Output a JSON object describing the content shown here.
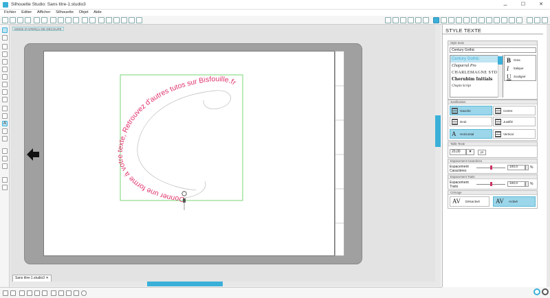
{
  "window": {
    "title": "Silhouette Studio: Sans titre-1.studio3",
    "min": "–",
    "max": "☐",
    "close": "✕"
  },
  "menu": [
    "Fichier",
    "Editer",
    "Afficher",
    "Silhouette",
    "Objet",
    "Aide"
  ],
  "document": {
    "tag": "MODE D'APERÇU DE DÉCOUPE",
    "tab_label": "Sans titre-1.studio3",
    "curved_text": "Donner une forme à votre texte, Retrouvez d'autres tutos sur Bisfouille.fr",
    "text_color": "#e0336b",
    "selection_color": "#55cc55"
  },
  "colors": {
    "accent": "#3ab0d8",
    "mat": "#a0a0a0",
    "workspace": "#e3e3e3"
  },
  "panel": {
    "title": "STYLE TEXTE",
    "font_section": {
      "header": "Style texte",
      "current_font": "Century Gothic",
      "fonts": [
        "Century Gothic",
        "Chaparral Pro",
        "CHARLEMAGNE STD",
        "Cherubim Initials",
        "Chopin Script"
      ],
      "styles": [
        {
          "glyph": "B",
          "label": "Gras"
        },
        {
          "glyph": "I",
          "label": "Italique"
        },
        {
          "glyph": "U",
          "label": "Souligné"
        }
      ]
    },
    "justification": {
      "header": "Justification",
      "options": [
        "Gauche",
        "Centre",
        "Droit",
        "Justifié"
      ],
      "directions": [
        "Horizontal",
        "Vertical"
      ]
    },
    "size": {
      "header": "Taille Texte",
      "value": "20,00",
      "unit": "pt",
      "dropdown": "▼"
    },
    "char_spacing": {
      "header": "Espacement Caractères",
      "label": "Espacement Caractères",
      "value": "100,0",
      "unit": "%",
      "level": 0.5
    },
    "line_spacing": {
      "header": "Espacement Traits",
      "label": "Espacement Traits",
      "value": "100,0",
      "unit": "%",
      "level": 0.5
    },
    "kerning": {
      "header": "Crénage",
      "off_label": "Désactivé",
      "on_label": "Activé",
      "glyph": "AV"
    }
  }
}
